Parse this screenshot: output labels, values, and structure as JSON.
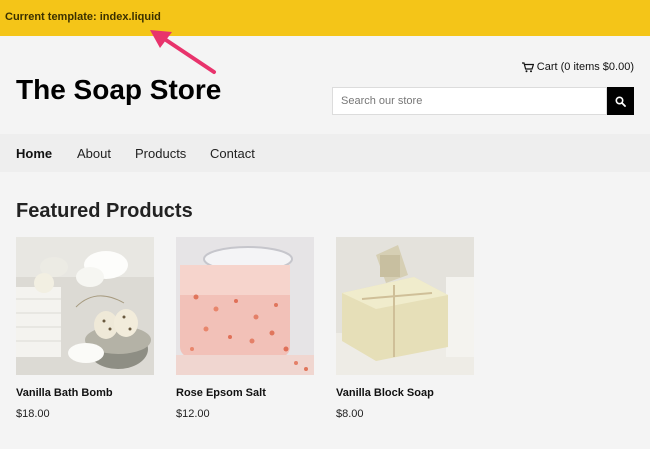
{
  "dev_banner": {
    "text": "Current template: index.liquid",
    "color": "#f4c518",
    "arrow_color": "#e8336c"
  },
  "header": {
    "store_title": "The Soap Store",
    "cart_label": "Cart (0 items $0.00)",
    "search": {
      "placeholder": "Search our store",
      "value": ""
    }
  },
  "nav": {
    "items": [
      {
        "label": "Home",
        "active": true
      },
      {
        "label": "About",
        "active": false
      },
      {
        "label": "Products",
        "active": false
      },
      {
        "label": "Contact",
        "active": false
      }
    ]
  },
  "featured": {
    "title": "Featured Products",
    "products": [
      {
        "name": "Vanilla Bath Bomb",
        "price": "$18.00"
      },
      {
        "name": "Rose Epsom Salt",
        "price": "$12.00"
      },
      {
        "name": "Vanilla Block Soap",
        "price": "$8.00"
      }
    ]
  }
}
